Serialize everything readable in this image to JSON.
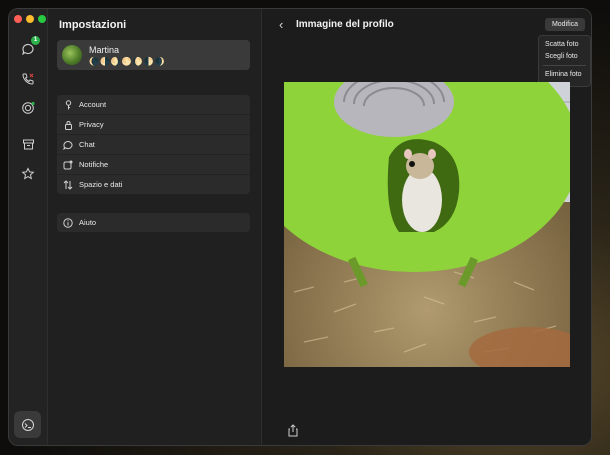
{
  "settings": {
    "title": "Impostazioni",
    "profile": {
      "name": "Martina",
      "status": "🌘🌗🌖🌕🌔🌓🌒"
    },
    "menu": [
      {
        "label": "Account",
        "icon": "key-icon"
      },
      {
        "label": "Privacy",
        "icon": "lock-icon"
      },
      {
        "label": "Chat",
        "icon": "chat-bubble-icon"
      },
      {
        "label": "Notifiche",
        "icon": "notification-icon"
      },
      {
        "label": "Spazio e dati",
        "icon": "data-transfer-icon"
      }
    ],
    "help": {
      "label": "Aiuto",
      "icon": "info-icon"
    }
  },
  "rail": {
    "chats_badge": "1",
    "icons": [
      "chats-icon",
      "calls-icon",
      "status-icon",
      "archive-icon",
      "starred-icon",
      "settings-avatar-icon"
    ]
  },
  "main": {
    "title": "Immagine del profilo",
    "edit_button": "Modifica",
    "dropdown": {
      "take_photo": "Scatta foto",
      "choose_photo": "Scegli foto",
      "delete_photo": "Elimina foto"
    }
  },
  "colors": {
    "accent_green": "#2eb24b",
    "window_bg": "#1c1c1c",
    "panel_bg": "#2b2b2b"
  }
}
